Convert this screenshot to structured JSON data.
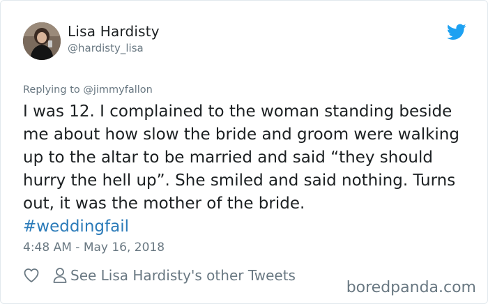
{
  "author": {
    "display_name": "Lisa Hardisty",
    "handle": "@hardisty_lisa",
    "avatar": "profile-photo"
  },
  "brand": {
    "icon": "twitter-bird-icon",
    "color": "#1da1f2"
  },
  "reply": {
    "prefix": "Replying to",
    "mention": "@jimmyfallon"
  },
  "tweet": {
    "text": "I was 12. I complained to the woman standing beside me about how slow the bride and groom were walking up to the altar to be married and said “they should hurry the hell up”. She smiled and said nothing. Turns out, it was the mother of the bride.",
    "hashtag": "#weddingfail",
    "timestamp": "4:48 AM - May 16, 2018"
  },
  "actions": {
    "like_icon": "heart-icon",
    "profile_icon": "person-icon",
    "other_tweets_label": "See Lisa Hardisty's other Tweets"
  },
  "colors": {
    "text": "#1c2022",
    "muted": "#697882",
    "link": "#2b7bb9"
  },
  "watermark": "boredpanda.com"
}
